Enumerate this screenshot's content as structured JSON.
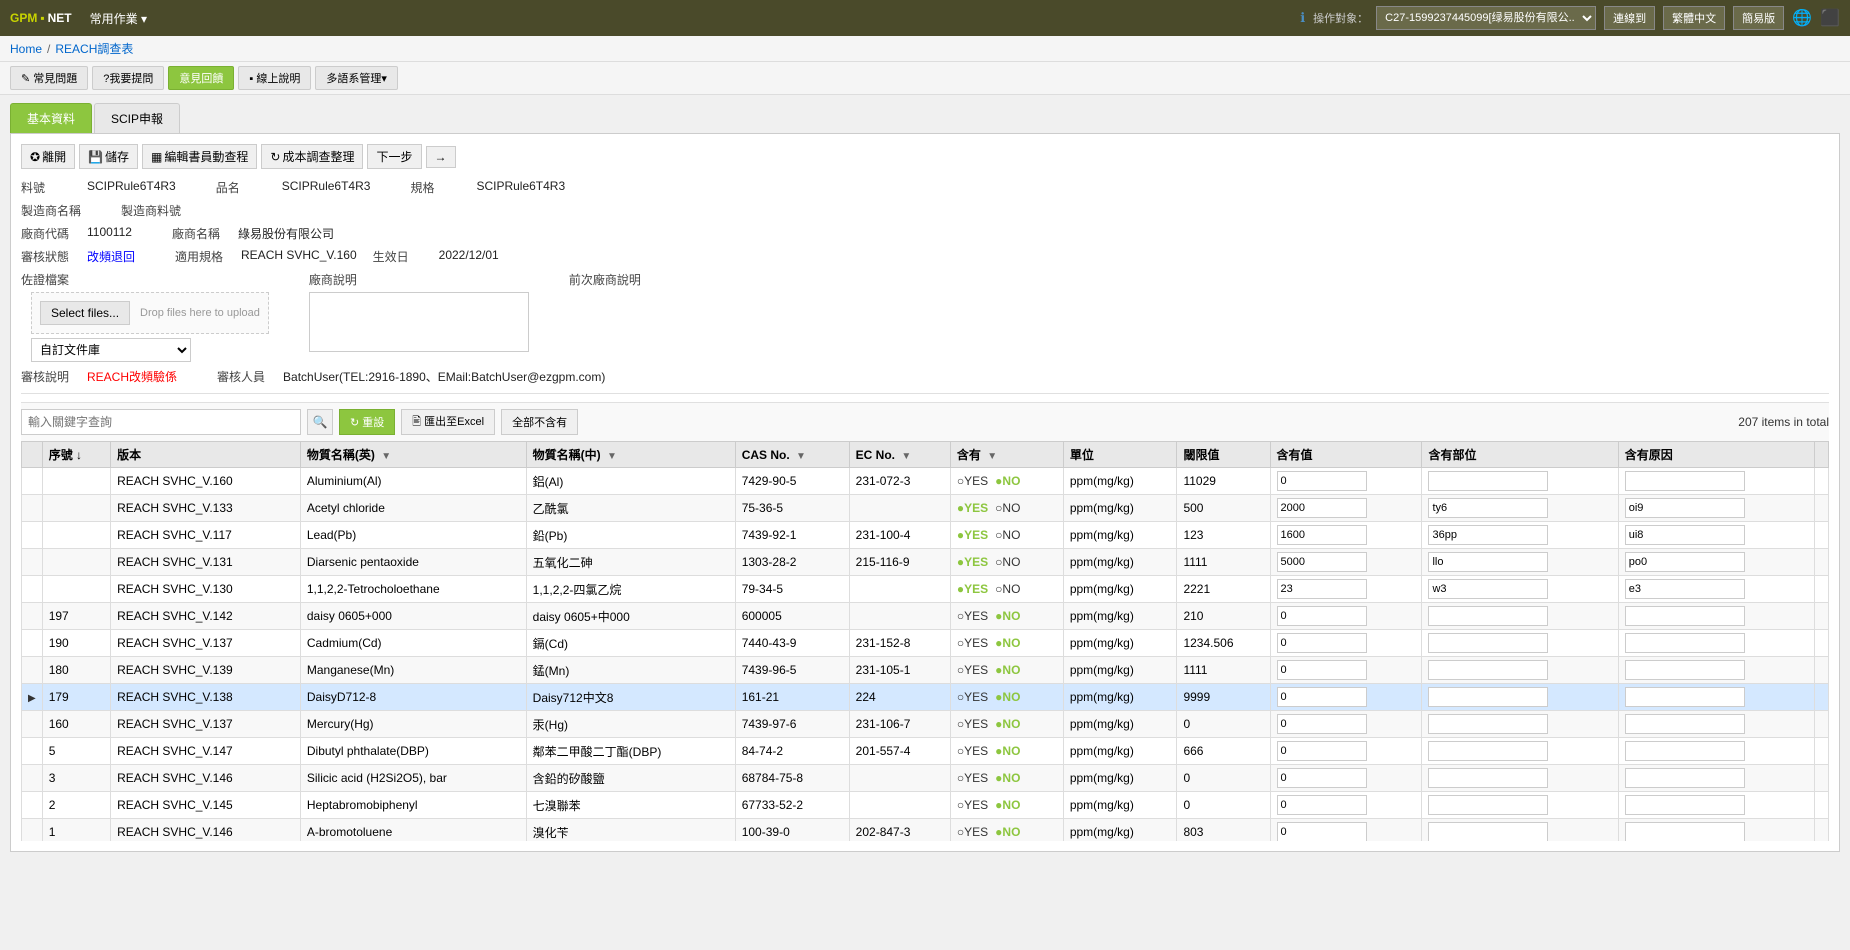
{
  "app": {
    "logo": "GPM",
    "logo_suffix": ".NET"
  },
  "top_nav": {
    "menu_label": "常用作業 ▾",
    "operator_label": "操作對象：",
    "operator_value": "C27-1599237445099[绿易股份有限公...",
    "btn_next": "連線到",
    "btn_lang1": "繁體中文",
    "btn_lang2": "簡易版"
  },
  "breadcrumb": {
    "home": "Home",
    "separator": "/",
    "reach": "REACH調查表"
  },
  "sub_nav": {
    "btn1": "✎ 常見問題",
    "btn2": "?我要提問",
    "btn3_active": "意見回饋",
    "btn4": "▪ 線上說明",
    "btn5": "多語系管理▾"
  },
  "tabs": {
    "tab1": "基本資料",
    "tab2": "SCIP申報"
  },
  "toolbar": {
    "btn_link": "✪ 離開",
    "btn_save": "💾 儲存",
    "btn_edit": "▦ 編輯書員動查程",
    "btn_refresh": "↻ 成本調查整理",
    "btn_next": "下一步",
    "btn_arrow": "→"
  },
  "form": {
    "label_material": "料號",
    "value_material": "SCIPRule6T4R3",
    "label_product": "品名",
    "value_product": "SCIPRule6T4R3",
    "label_spec": "規格",
    "value_spec": "SCIPRule6T4R3",
    "label_mfr_name": "製造商名稱",
    "label_mfr_material": "製造商料號",
    "label_vendor_code": "廠商代碼",
    "value_vendor_code": "1100112",
    "label_vendor_name2": "廠商名稱",
    "value_vendor_name2": "綠易股份有限公司",
    "label_review_status": "審核狀態",
    "value_review_status": "改頻退回",
    "label_applicable": "適用規格",
    "value_applicable": "REACH SVHC_V.160",
    "label_effective": "生效日",
    "value_effective": "2022/12/01",
    "label_evidence": "佐證檔案",
    "btn_select_files": "Select files...",
    "upload_hint": "Drop files here to upload",
    "dropdown_placeholder": "自訂文件庫",
    "label_vendor_comment": "廠商說明",
    "label_prev_vendor_comment": "前次廠商說明",
    "label_review_note": "審核說明",
    "value_review_note": "REACH改頻驗係",
    "label_reviewer": "審核人員",
    "value_reviewer": "BatchUser(TEL:2916-1890、EMail:BatchUser@ezgpm.com)"
  },
  "table_toolbar": {
    "search_placeholder": "輸入關鍵字查詢",
    "btn_reset": "↻ 重設",
    "btn_export": "🖹 匯出至Excel",
    "btn_all_no": "全部不含有",
    "total": "207 items in total"
  },
  "table": {
    "headers": [
      "",
      "序號 ↓",
      "版本",
      "物質名稱(英)",
      "物質名稱(中)",
      "CAS No.",
      "EC No.",
      "含有",
      "單位",
      "閾限值",
      "含有值",
      "含有部位",
      "含有原因"
    ],
    "rows": [
      {
        "seq": "",
        "version": "REACH SVHC_V.160",
        "name_en": "Aluminium(Al)",
        "name_zh": "鋁(Al)",
        "cas": "7429-90-5",
        "ec": "231-072-3",
        "contain": "YES●NO",
        "unit": "ppm(mg/kg)",
        "threshold": "11029",
        "value": "0",
        "location": "",
        "reason": "",
        "expanded": false,
        "selected": false
      },
      {
        "seq": "",
        "version": "REACH SVHC_V.133",
        "name_en": "Acetyl chloride",
        "name_zh": "乙酰氯",
        "cas": "75-36-5",
        "ec": "",
        "contain": "●YES NO",
        "unit": "ppm(mg/kg)",
        "threshold": "500",
        "value": "2000",
        "location": "ty6",
        "reason": "oi9",
        "expanded": false,
        "selected": false
      },
      {
        "seq": "",
        "version": "REACH SVHC_V.117",
        "name_en": "Lead(Pb)",
        "name_zh": "鉛(Pb)",
        "cas": "7439-92-1",
        "ec": "231-100-4",
        "contain": "●YES NO",
        "unit": "ppm(mg/kg)",
        "threshold": "123",
        "value": "1600",
        "location": "36pp",
        "reason": "ui8",
        "expanded": false,
        "selected": false
      },
      {
        "seq": "",
        "version": "REACH SVHC_V.131",
        "name_en": "Diarsenic pentaoxide",
        "name_zh": "五氧化二砷",
        "cas": "1303-28-2",
        "ec": "215-116-9",
        "contain": "●YES NO",
        "unit": "ppm(mg/kg)",
        "threshold": "1111",
        "value": "5000",
        "location": "llo",
        "reason": "po0",
        "expanded": false,
        "selected": false
      },
      {
        "seq": "",
        "version": "REACH SVHC_V.130",
        "name_en": "1,1,2,2-Tetrocholoethane",
        "name_zh": "1,1,2,2-四氯乙烷",
        "cas": "79-34-5",
        "ec": "",
        "contain": "●YES NO",
        "unit": "ppm(mg/kg)",
        "threshold": "2221",
        "value": "23",
        "location": "w3",
        "reason": "e3",
        "expanded": false,
        "selected": false
      },
      {
        "seq": "197",
        "version": "REACH SVHC_V.142",
        "name_en": "daisy 0605+000",
        "name_zh": "daisy 0605+中000",
        "cas": "600005",
        "ec": "",
        "contain": "YES●NO",
        "unit": "ppm(mg/kg)",
        "threshold": "210",
        "value": "0",
        "location": "",
        "reason": "",
        "expanded": false,
        "selected": false
      },
      {
        "seq": "190",
        "version": "REACH SVHC_V.137",
        "name_en": "Cadmium(Cd)",
        "name_zh": "鎘(Cd)",
        "cas": "7440-43-9",
        "ec": "231-152-8",
        "contain": "YES●NO",
        "unit": "ppm(mg/kg)",
        "threshold": "1234.506",
        "value": "0",
        "location": "",
        "reason": "",
        "expanded": false,
        "selected": false
      },
      {
        "seq": "180",
        "version": "REACH SVHC_V.139",
        "name_en": "Manganese(Mn)",
        "name_zh": "錳(Mn)",
        "cas": "7439-96-5",
        "ec": "231-105-1",
        "contain": "YES●NO",
        "unit": "ppm(mg/kg)",
        "threshold": "1111",
        "value": "0",
        "location": "",
        "reason": "",
        "expanded": false,
        "selected": false
      },
      {
        "seq": "179",
        "version": "REACH SVHC_V.138",
        "name_en": "DaisyD712-8",
        "name_zh": "Daisy712中文8",
        "cas": "161-21",
        "ec": "224",
        "contain": "YES●NO",
        "unit": "ppm(mg/kg)",
        "threshold": "9999",
        "value": "0",
        "location": "",
        "reason": "",
        "expanded": true,
        "selected": true
      },
      {
        "seq": "160",
        "version": "REACH SVHC_V.137",
        "name_en": "Mercury(Hg)",
        "name_zh": "汞(Hg)",
        "cas": "7439-97-6",
        "ec": "231-106-7",
        "contain": "YES●NO",
        "unit": "ppm(mg/kg)",
        "threshold": "0",
        "value": "0",
        "location": "",
        "reason": "",
        "expanded": false,
        "selected": false
      },
      {
        "seq": "5",
        "version": "REACH SVHC_V.147",
        "name_en": "Dibutyl phthalate(DBP)",
        "name_zh": "鄰苯二甲酸二丁酯(DBP)",
        "cas": "84-74-2",
        "ec": "201-557-4",
        "contain": "YES●NO",
        "unit": "ppm(mg/kg)",
        "threshold": "666",
        "value": "0",
        "location": "",
        "reason": "",
        "expanded": false,
        "selected": false
      },
      {
        "seq": "3",
        "version": "REACH SVHC_V.146",
        "name_en": "Silicic acid (H2Si2O5), bar",
        "name_zh": "含鉛的矽酸鹽",
        "cas": "68784-75-8",
        "ec": "",
        "contain": "YES●NO",
        "unit": "ppm(mg/kg)",
        "threshold": "0",
        "value": "0",
        "location": "",
        "reason": "",
        "expanded": false,
        "selected": false
      },
      {
        "seq": "2",
        "version": "REACH SVHC_V.145",
        "name_en": "Heptabromobiphenyl",
        "name_zh": "七溴聯苯",
        "cas": "67733-52-2",
        "ec": "",
        "contain": "YES●NO",
        "unit": "ppm(mg/kg)",
        "threshold": "0",
        "value": "0",
        "location": "",
        "reason": "",
        "expanded": false,
        "selected": false
      },
      {
        "seq": "1",
        "version": "REACH SVHC_V.146",
        "name_en": "A-bromotoluene",
        "name_zh": "溴化苄",
        "cas": "100-39-0",
        "ec": "202-847-3",
        "contain": "YES●NO",
        "unit": "ppm(mg/kg)",
        "threshold": "803",
        "value": "0",
        "location": "",
        "reason": "",
        "expanded": false,
        "selected": false
      }
    ]
  }
}
